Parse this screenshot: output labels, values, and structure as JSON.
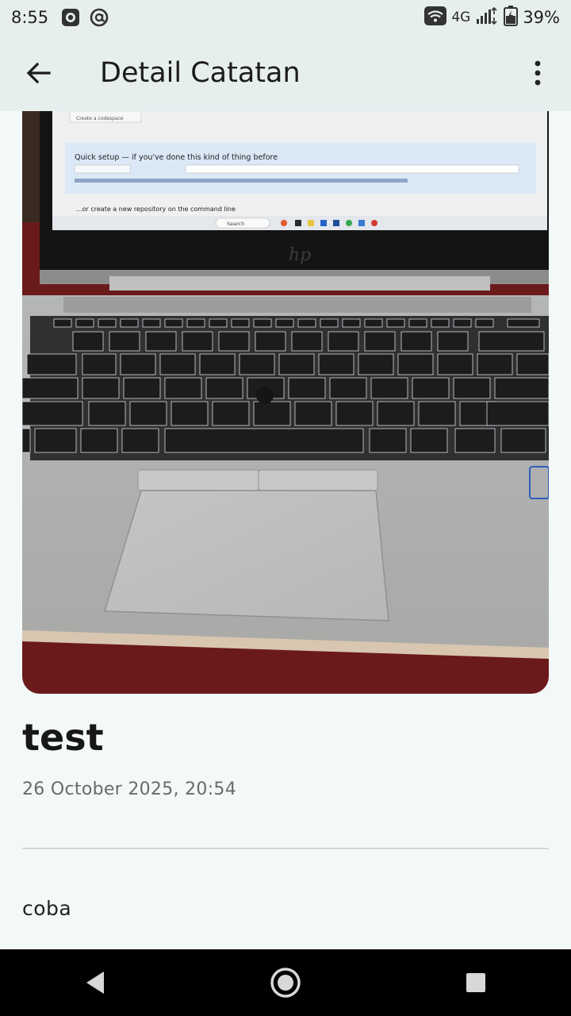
{
  "status_bar": {
    "time": "8:55",
    "network": "4G",
    "battery": "39%",
    "icons": [
      "record-icon",
      "at-icon",
      "wifi-icon",
      "signal-icon",
      "battery-icon"
    ]
  },
  "app_bar": {
    "title": "Detail Catatan",
    "back_icon": "arrow-left-icon",
    "menu_icon": "more-vert-icon"
  },
  "note": {
    "image": "laptop-photo",
    "title": "test",
    "date": "26 October 2025, 20:54",
    "body": "coba"
  },
  "photo_text": {
    "create_codespace": "Create a codespace",
    "quick_setup": "Quick setup — if you've done this kind of thing before",
    "cli_heading": "...or create a new repository on the command line",
    "search": "Search"
  },
  "nav_bar": {
    "icons": [
      "back-triangle-icon",
      "home-circle-icon",
      "recents-square-icon"
    ]
  },
  "colors": {
    "background": "#f3f8f8",
    "app_bar": "#e7eeee",
    "nav_bar": "#000000",
    "text_primary": "#171717",
    "text_secondary": "#6a6a6a"
  }
}
